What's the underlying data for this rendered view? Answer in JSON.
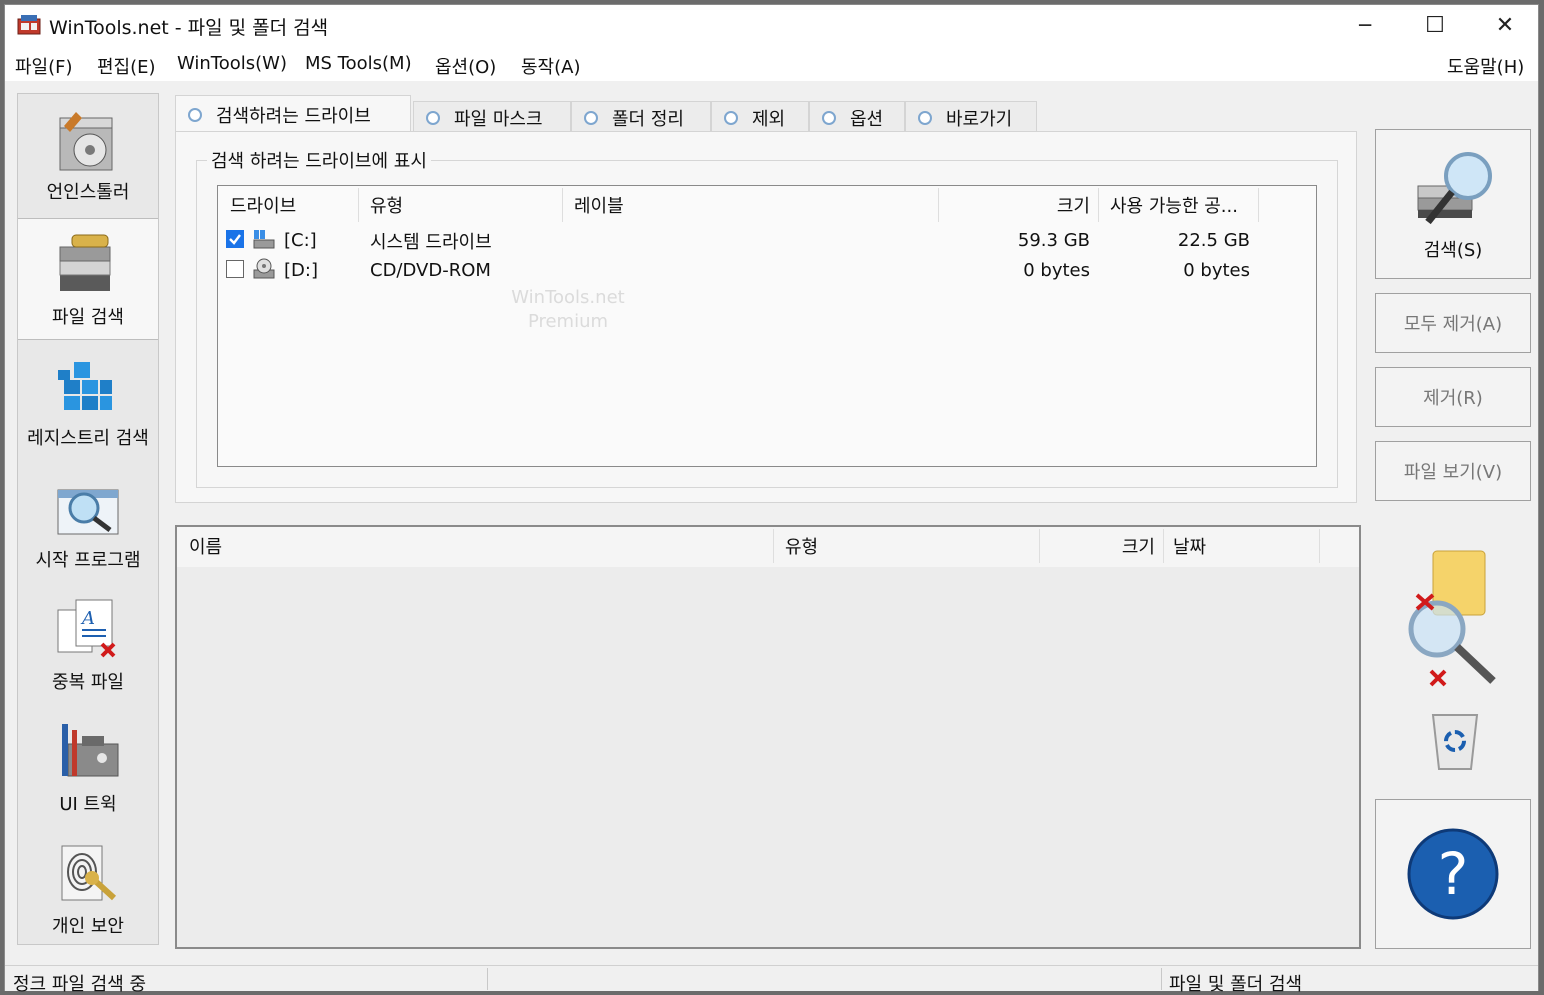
{
  "window": {
    "title": "WinTools.net - 파일 및 폴더 검색",
    "minimize_glyph": "─",
    "maximize_glyph": "☐",
    "close_glyph": "✕"
  },
  "menu": {
    "items": [
      "파일(F)",
      "편집(E)",
      "WinTools(W)",
      "MS Tools(M)",
      "옵션(O)",
      "동작(A)"
    ],
    "help": "도움말(H)"
  },
  "sidebar": {
    "items": [
      {
        "label": "언인스톨러",
        "icon": "uninstaller-icon"
      },
      {
        "label": "파일 검색",
        "icon": "file-search-icon"
      },
      {
        "label": "레지스트리 검색",
        "icon": "registry-search-icon"
      },
      {
        "label": "시작 프로그램",
        "icon": "startup-programs-icon"
      },
      {
        "label": "중복 파일",
        "icon": "duplicate-files-icon"
      },
      {
        "label": "UI 트윅",
        "icon": "ui-tweak-icon"
      },
      {
        "label": "개인 보안",
        "icon": "privacy-icon"
      }
    ],
    "active_index": 1
  },
  "tabs": [
    "검색하려는 드라이브",
    "파일 마스크",
    "폴더 정리",
    "제외",
    "옵션",
    "바로가기"
  ],
  "drives_group": {
    "legend": "검색 하려는 드라이브에 표시",
    "columns": [
      "드라이브",
      "유형",
      "레이블",
      "크기",
      "사용 가능한 공..."
    ],
    "rows": [
      {
        "checked": true,
        "drive": "[C:]",
        "type": "시스템 드라이브",
        "label": "",
        "size": "59.3 GB",
        "free": "22.5 GB",
        "icon": "hard-drive-icon"
      },
      {
        "checked": false,
        "drive": "[D:]",
        "type": "CD/DVD-ROM",
        "label": "",
        "size": "0 bytes",
        "free": "0 bytes",
        "icon": "cd-drive-icon"
      }
    ],
    "watermark_line1": "WinTools.net",
    "watermark_line2": "Premium"
  },
  "results": {
    "columns": [
      "이름",
      "유형",
      "크기",
      "날짜"
    ]
  },
  "buttons": {
    "search": "검색(S)",
    "remove_all": "모두 제거(A)",
    "remove": "제거(R)",
    "view_file": "파일 보기(V)",
    "help_glyph": "?"
  },
  "status": {
    "left": "정크 파일 검색 중",
    "right": "파일 및 폴더 검색"
  },
  "colors": {
    "accent": "#1a73e8",
    "help_circle": "#1b5fb0",
    "delete_red": "#d11a1a"
  }
}
